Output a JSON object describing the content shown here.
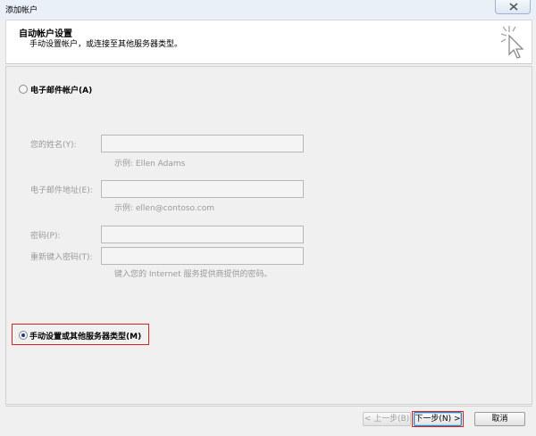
{
  "window": {
    "title": "添加帐户"
  },
  "header": {
    "title": "自动帐户设置",
    "subtitle": "手动设置帐户，或连接至其他服务器类型。"
  },
  "email_option": {
    "label": "电子邮件帐户(A)",
    "selected": false
  },
  "form": {
    "name_label": "您的姓名(Y):",
    "name_value": "",
    "name_hint": "示例: Ellen Adams",
    "email_label": "电子邮件地址(E):",
    "email_value": "",
    "email_hint": "示例: ellen@contoso.com",
    "password_label": "密码(P):",
    "password_value": "",
    "retype_label": "重新键入密码(T):",
    "retype_value": "",
    "password_hint": "键入您的 Internet 服务提供商提供的密码。"
  },
  "manual_option": {
    "label": "手动设置或其他服务器类型(M)",
    "selected": true
  },
  "buttons": {
    "back": "< 上一步(B)",
    "next": "下一步(N) >",
    "cancel": "取消"
  },
  "colors": {
    "highlight": "#d2232a",
    "accent": "#3c7fb1"
  }
}
